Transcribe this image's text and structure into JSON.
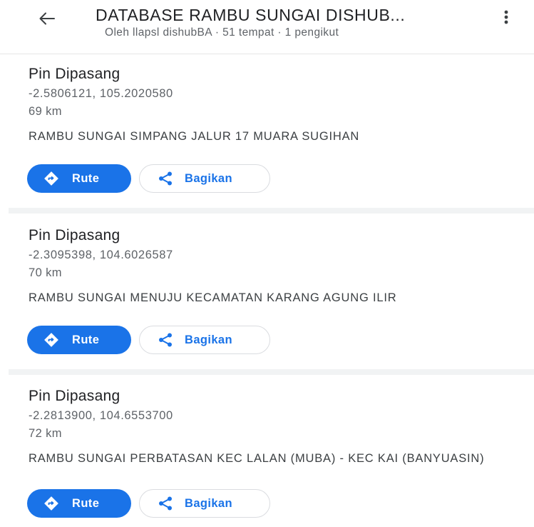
{
  "header": {
    "title": "DATABASE RAMBU SUNGAI DISHUB...",
    "subtitle": "Oleh llapsl dishubBA · 51 tempat · 1 pengikut",
    "back_icon": "arrow-left-icon",
    "more_icon": "more-vert-icon"
  },
  "colors": {
    "accent": "#1a73e8",
    "divider": "#f1f3f4",
    "secondary_text": "#5f6368"
  },
  "places": [
    {
      "title": "Pin Dipasang",
      "coords": "-2.5806121, 105.2020580",
      "distance": "69 km",
      "description": "RAMBU SUNGAI SIMPANG JALUR 17 MUARA SUGIHAN",
      "route_label": "Rute",
      "share_label": "Bagikan"
    },
    {
      "title": "Pin Dipasang",
      "coords": "-2.3095398, 104.6026587",
      "distance": "70 km",
      "description": "RAMBU SUNGAI MENUJU KECAMATAN KARANG AGUNG ILIR",
      "route_label": "Rute",
      "share_label": "Bagikan"
    },
    {
      "title": "Pin Dipasang",
      "coords": "-2.2813900, 104.6553700",
      "distance": "72 km",
      "description": "RAMBU SUNGAI PERBATASAN KEC LALAN (MUBA) - KEC KAI (BANYUASIN)",
      "route_label": "Rute",
      "share_label": "Bagikan"
    }
  ]
}
